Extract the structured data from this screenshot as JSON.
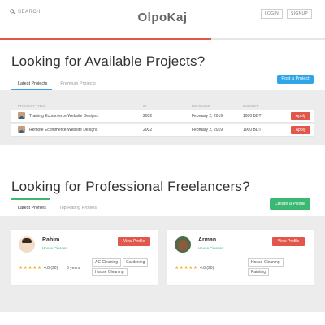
{
  "header": {
    "search_label": "SEARCH",
    "logo": "OlpoKaj",
    "login_label": "LOGIN",
    "signup_label": "SIGNUP"
  },
  "projects": {
    "title": "Looking for Available Projects?",
    "tabs": [
      "Latest Projects",
      "Premium Projects"
    ],
    "post_button": "Post a Project",
    "columns": [
      "PROJECT TITLE",
      "ID",
      "DEADLINE",
      "BUDGET"
    ],
    "rows": [
      {
        "title": "Training Ecommerce Website Designs",
        "id": "2002",
        "deadline": "February 2, 2019",
        "budget": "1000 BDT",
        "action": "Apply"
      },
      {
        "title": "Remote Ecommerce Website Designs",
        "id": "2002",
        "deadline": "February 2, 2019",
        "budget": "1000 BDT",
        "action": "Apply"
      }
    ]
  },
  "freelancers": {
    "title": "Looking for Professional Freelancers?",
    "tabs": [
      "Latest Profiles",
      "Top Rating Profiles"
    ],
    "create_button": "Create a Profile",
    "cards": [
      {
        "name": "Rahim",
        "role": "House Cleaner",
        "view_label": "View Profile",
        "stars": "★★★★★",
        "rating": "4.8 (20)",
        "experience": "3 years",
        "skills": [
          "AC Cleaning",
          "Gardening",
          "House Cleaning"
        ]
      },
      {
        "name": "Arman",
        "role": "House Cleaner",
        "view_label": "View Profile",
        "stars": "★★★★★",
        "rating": "4.8 (20)",
        "skills": [
          "House Cleaning",
          "Painting"
        ]
      }
    ]
  },
  "colors": {
    "accent_red": "#e2574c",
    "accent_blue": "#2fa4e7",
    "accent_green": "#3bb872",
    "panel_gray": "#ececec"
  }
}
